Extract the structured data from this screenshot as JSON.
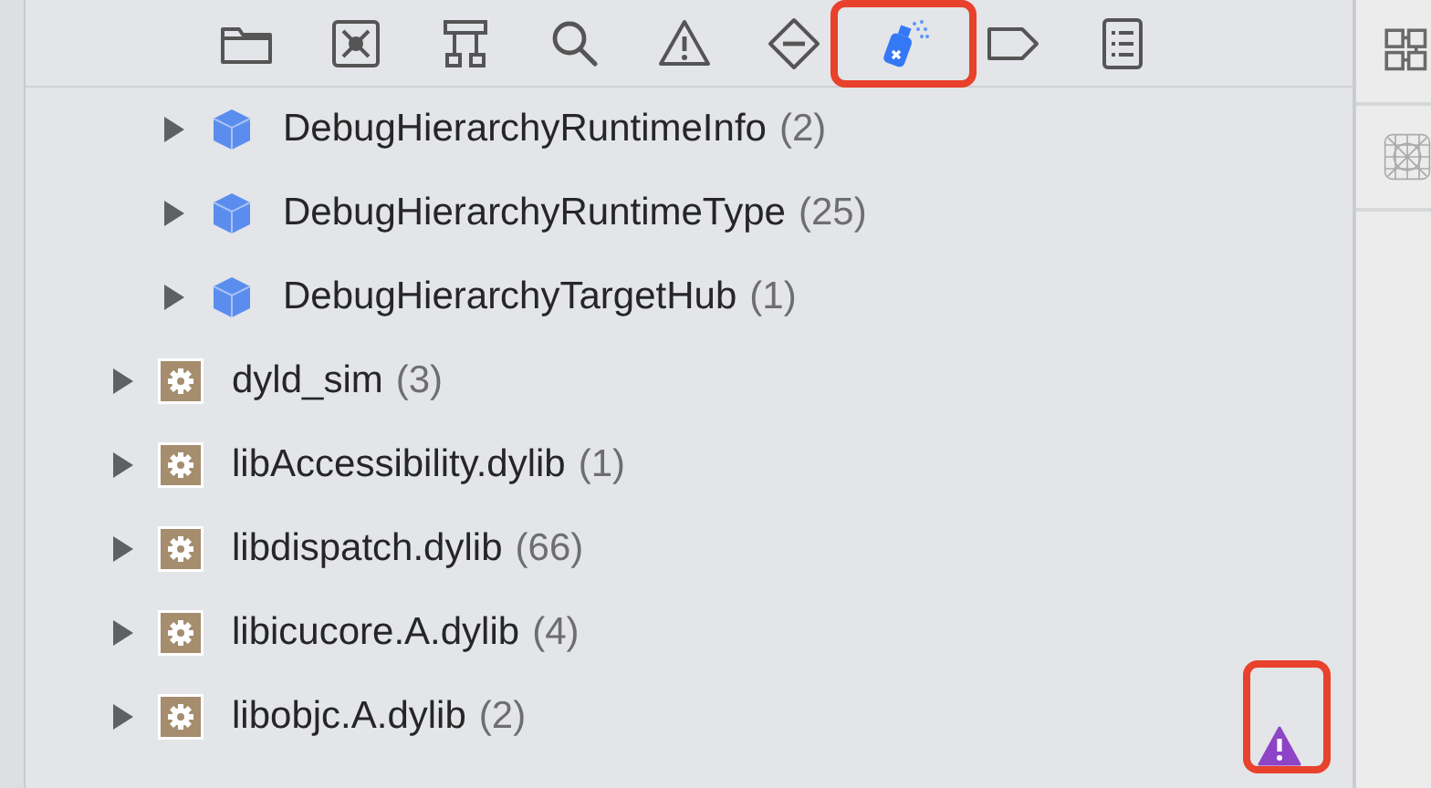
{
  "navigator_tabs": [
    {
      "selected": false
    },
    {
      "selected": false
    },
    {
      "selected": false
    },
    {
      "selected": false
    },
    {
      "selected": false
    },
    {
      "selected": false
    },
    {
      "selected": true,
      "highlighted": true
    },
    {
      "selected": false
    },
    {
      "selected": false
    }
  ],
  "tree": [
    {
      "children": [
        {
          "kind": "class",
          "name": "DebugHierarchyRuntimeInfo",
          "count": "(2)",
          "expanded": false
        },
        {
          "kind": "class",
          "name": "DebugHierarchyRuntimeType",
          "count": "(25)",
          "expanded": false
        },
        {
          "kind": "class",
          "name": "DebugHierarchyTargetHub",
          "count": "(1)",
          "expanded": false
        }
      ]
    },
    {
      "kind": "library",
      "name": "dyld_sim",
      "count": "(3)",
      "expanded": false
    },
    {
      "kind": "library",
      "name": "libAccessibility.dylib",
      "count": "(1)",
      "expanded": false
    },
    {
      "kind": "library",
      "name": "libdispatch.dylib",
      "count": "(66)",
      "expanded": false
    },
    {
      "kind": "library",
      "name": "libicucore.A.dylib",
      "count": "(4)",
      "expanded": false
    },
    {
      "kind": "library",
      "name": "libobjc.A.dylib",
      "count": "(2)",
      "expanded": false
    }
  ],
  "runtime_issue": {
    "highlighted": true
  }
}
